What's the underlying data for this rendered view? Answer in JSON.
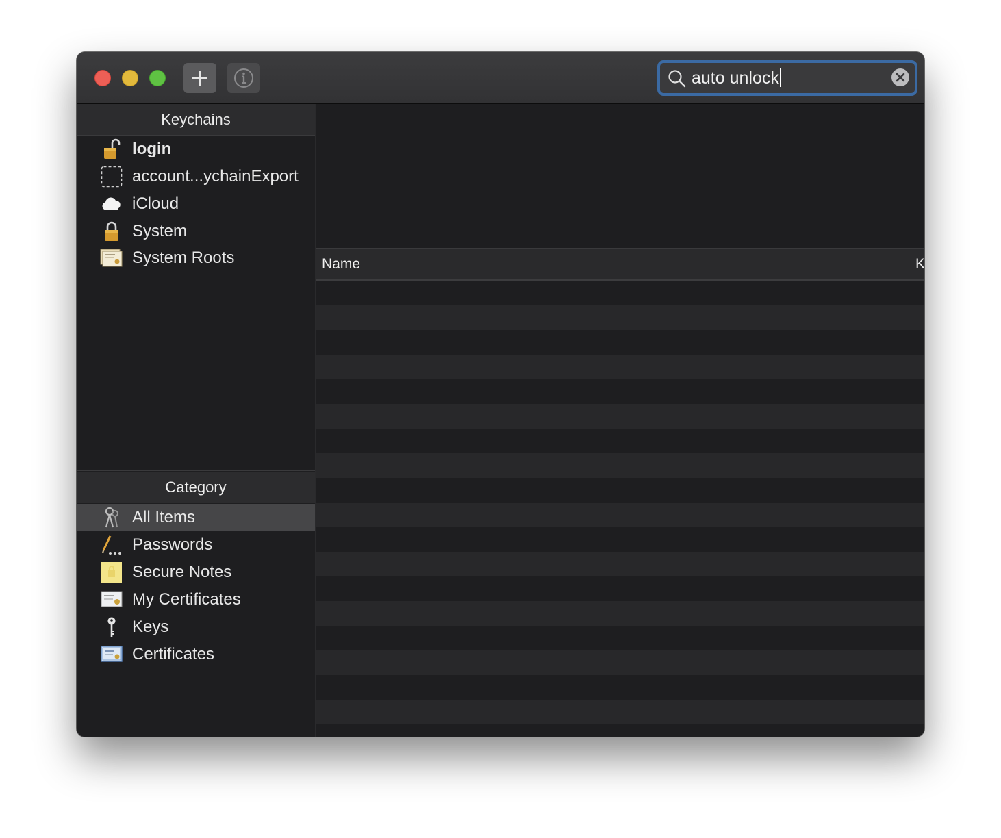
{
  "toolbar": {
    "add_icon": "plus-icon",
    "info_icon": "info-icon"
  },
  "search": {
    "value": "auto unlock",
    "icon": "magnifying-glass-icon",
    "clear_icon": "clear-icon"
  },
  "keychains": {
    "header": "Keychains",
    "items": [
      {
        "label": "login",
        "icon": "unlocked-padlock-icon",
        "bold": true
      },
      {
        "label": "account...ychainExport",
        "icon": "dashed-keychain-icon"
      },
      {
        "label": "iCloud",
        "icon": "cloud-icon"
      },
      {
        "label": "System",
        "icon": "padlock-icon"
      },
      {
        "label": "System Roots",
        "icon": "certificate-stack-icon"
      }
    ]
  },
  "category": {
    "header": "Category",
    "items": [
      {
        "label": "All Items",
        "icon": "keys-icon",
        "selected": true
      },
      {
        "label": "Passwords",
        "icon": "pencil-dots-icon"
      },
      {
        "label": "Secure Notes",
        "icon": "note-icon"
      },
      {
        "label": "My Certificates",
        "icon": "certificate-icon"
      },
      {
        "label": "Keys",
        "icon": "key-icon"
      },
      {
        "label": "Certificates",
        "icon": "certificate-blue-icon"
      }
    ]
  },
  "table": {
    "columns": [
      "Name",
      "K"
    ],
    "rows": []
  },
  "colors": {
    "window_bg": "#1e1e20",
    "selection": "#464648",
    "search_focus": "#3b6aa3"
  }
}
